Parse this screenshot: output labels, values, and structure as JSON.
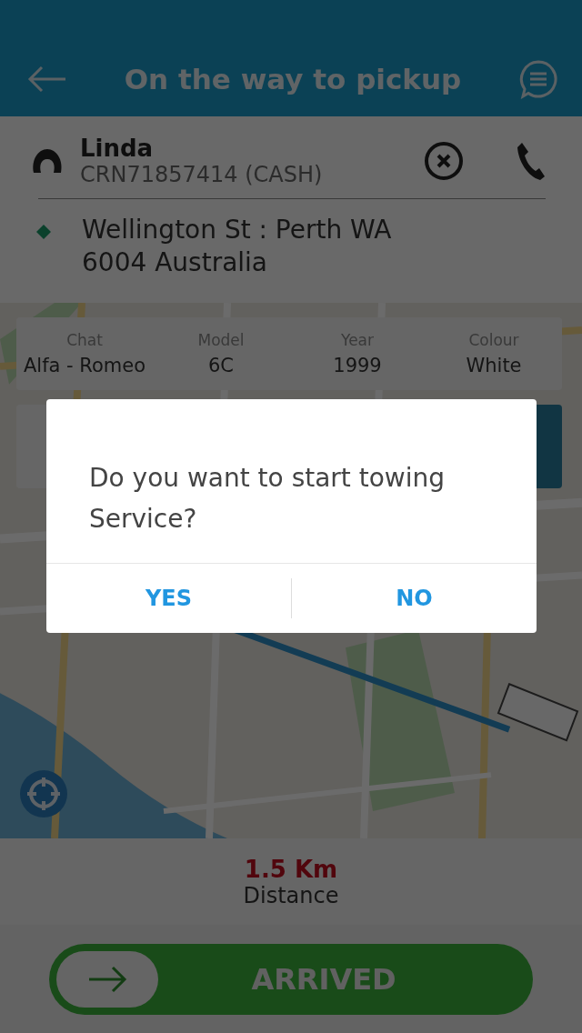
{
  "header": {
    "title": "On the way to pickup"
  },
  "passenger": {
    "name": "Linda",
    "reference": "CRN71857414 (CASH)"
  },
  "pickup": {
    "address": "Wellington St : Perth WA 6004 Australia"
  },
  "vehicle": [
    {
      "label": "Chat",
      "value": "Alfa - Romeo"
    },
    {
      "label": "Model",
      "value": "6C"
    },
    {
      "label": "Year",
      "value": "1999"
    },
    {
      "label": "Colour",
      "value": "White"
    }
  ],
  "distance": {
    "value": "1.5 Km",
    "label": "Distance"
  },
  "slider": {
    "label": "ARRIVED",
    "level": 0
  },
  "dialog": {
    "message": "Do you want to start towing Service?",
    "buttons": [
      "YES",
      "NO"
    ]
  }
}
